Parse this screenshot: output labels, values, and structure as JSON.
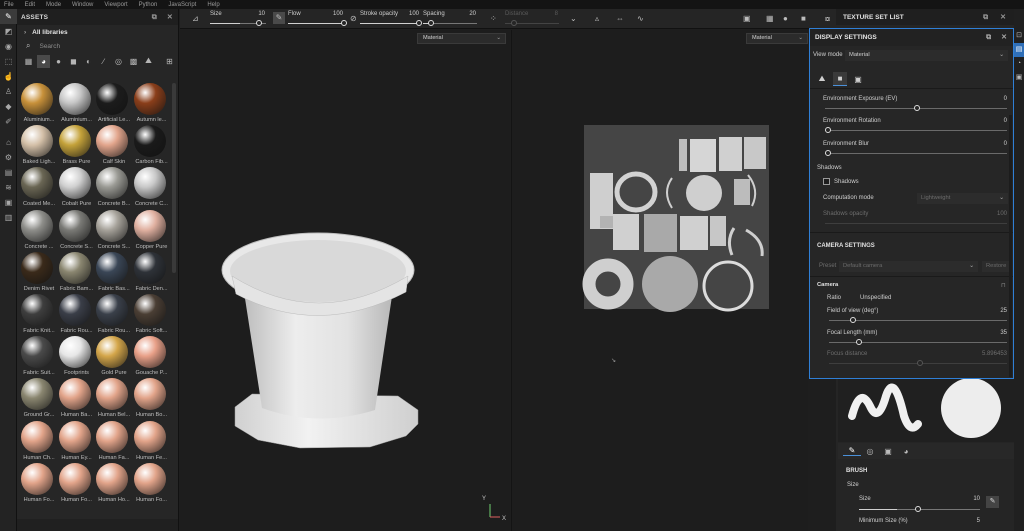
{
  "menu": [
    "File",
    "Edit",
    "Mode",
    "Window",
    "Viewport",
    "Python",
    "JavaScript",
    "Help"
  ],
  "assets": {
    "title": "ASSETS",
    "library": "All libraries",
    "search_placeholder": "Search",
    "items": [
      {
        "label": "Aluminium...",
        "color": "#c8913a"
      },
      {
        "label": "Aluminium...",
        "color": "#c6c6c6"
      },
      {
        "label": "Artificial Le...",
        "color": "#1c1c1c"
      },
      {
        "label": "Autumn le...",
        "color": "#8a3e1a"
      },
      {
        "label": "Baked Ligh...",
        "color": "#d4c0a8"
      },
      {
        "label": "Brass Pure",
        "color": "#c4a23a"
      },
      {
        "label": "Calf Skin",
        "color": "#e2a58c"
      },
      {
        "label": "Carbon Fib...",
        "color": "#1a1a1a"
      },
      {
        "label": "Coated Me...",
        "color": "#6a6654"
      },
      {
        "label": "Cobalt Pure",
        "color": "#d0d0d0"
      },
      {
        "label": "Concrete B...",
        "color": "#9a9a94"
      },
      {
        "label": "Concrete C...",
        "color": "#c8c8c8"
      },
      {
        "label": "Concrete ...",
        "color": "#8e8e8a"
      },
      {
        "label": "Concrete S...",
        "color": "#7a7a76"
      },
      {
        "label": "Concrete S...",
        "color": "#a6a29a"
      },
      {
        "label": "Copper Pure",
        "color": "#e0b0a0"
      },
      {
        "label": "Denim Rivet",
        "color": "#3a2a1a"
      },
      {
        "label": "Fabric Bam...",
        "color": "#8a8670"
      },
      {
        "label": "Fabric Bas...",
        "color": "#3a4656"
      },
      {
        "label": "Fabric Den...",
        "color": "#2e3238"
      },
      {
        "label": "Fabric Knit...",
        "color": "#3e3e3e"
      },
      {
        "label": "Fabric Rou...",
        "color": "#3a3e48"
      },
      {
        "label": "Fabric Rou...",
        "color": "#3a404a"
      },
      {
        "label": "Fabric Soft...",
        "color": "#4a3e34"
      },
      {
        "label": "Fabric Suit...",
        "color": "#4a4a4a"
      },
      {
        "label": "Footprints",
        "color": "#e6e6e6"
      },
      {
        "label": "Gold Pure",
        "color": "#d4a64a"
      },
      {
        "label": "Gouache P...",
        "color": "#e8a088"
      },
      {
        "label": "Ground Gr...",
        "color": "#8a8670"
      },
      {
        "label": "Human Ba...",
        "color": "#e2a48a"
      },
      {
        "label": "Human Bel...",
        "color": "#e2a48a"
      },
      {
        "label": "Human Bo...",
        "color": "#e2a48a"
      },
      {
        "label": "Human Ch...",
        "color": "#e2a48a"
      },
      {
        "label": "Human Ey...",
        "color": "#e2a48a"
      },
      {
        "label": "Human Fa...",
        "color": "#e2a48a"
      },
      {
        "label": "Human Fe...",
        "color": "#e2a48a"
      },
      {
        "label": "Human Fo...",
        "color": "#e2a48a"
      },
      {
        "label": "Human Fo...",
        "color": "#e2a48a"
      },
      {
        "label": "Human Ho...",
        "color": "#e2a48a"
      },
      {
        "label": "Human Fo...",
        "color": "#e2a48a"
      }
    ]
  },
  "toolbar": {
    "size_label": "Size",
    "size_value": "10",
    "flow_label": "Flow",
    "flow_value": "100",
    "stroke_label": "Stroke opacity",
    "stroke_value": "100",
    "spacing_label": "Spacing",
    "spacing_value": "20",
    "distance_label": "Distance",
    "distance_value": "8"
  },
  "viewport": {
    "material_3d": "Material",
    "material_2d": "Material"
  },
  "texture_set_list": {
    "title": "TEXTURE SET LIST"
  },
  "display_settings": {
    "title": "DISPLAY SETTINGS",
    "view_mode_label": "View mode",
    "view_mode_value": "Material",
    "env_exposure_label": "Environment Exposure (EV)",
    "env_exposure_value": "0",
    "env_rotation_label": "Environment Rotation",
    "env_rotation_value": "0",
    "env_blur_label": "Environment Blur",
    "env_blur_value": "0",
    "shadows_heading": "Shadows",
    "shadows_checkbox": "Shadows",
    "computation_label": "Computation mode",
    "computation_value": "Lightweight",
    "shadows_opacity_label": "Shadows opacity",
    "shadows_opacity_value": "100",
    "camera_settings_heading": "CAMERA SETTINGS",
    "preset_label": "Preset",
    "preset_value": "Default camera",
    "restore_label": "Restore",
    "camera_heading": "Camera",
    "ratio_label": "Ratio",
    "ratio_value": "Unspecified",
    "fov_label": "Field of view (deg°)",
    "fov_value": "25",
    "focal_label": "Focal Length (mm)",
    "focal_value": "35",
    "focus_label": "Focus distance",
    "focus_value": "5.896453"
  },
  "brush": {
    "heading": "BRUSH",
    "size_section": "Size",
    "size_label": "Size",
    "size_value": "10",
    "min_size_label": "Minimum Size (%)",
    "min_size_value": "5"
  }
}
